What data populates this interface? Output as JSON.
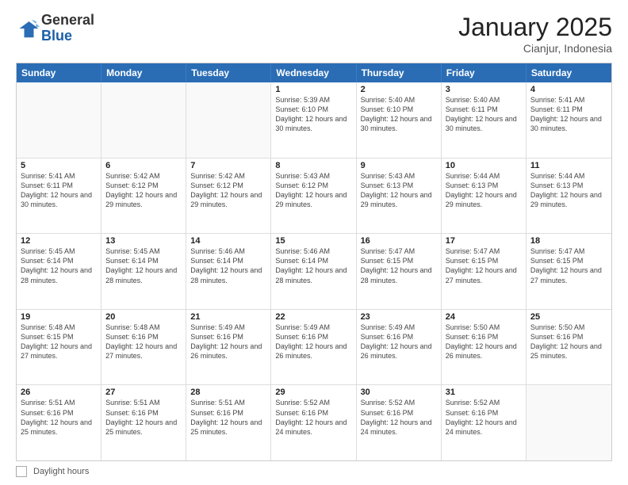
{
  "header": {
    "logo_general": "General",
    "logo_blue": "Blue",
    "month": "January 2025",
    "location": "Cianjur, Indonesia"
  },
  "footer": {
    "label": "Daylight hours"
  },
  "days": [
    "Sunday",
    "Monday",
    "Tuesday",
    "Wednesday",
    "Thursday",
    "Friday",
    "Saturday"
  ],
  "rows": [
    [
      {
        "day": "",
        "info": ""
      },
      {
        "day": "",
        "info": ""
      },
      {
        "day": "",
        "info": ""
      },
      {
        "day": "1",
        "info": "Sunrise: 5:39 AM\nSunset: 6:10 PM\nDaylight: 12 hours and 30 minutes."
      },
      {
        "day": "2",
        "info": "Sunrise: 5:40 AM\nSunset: 6:10 PM\nDaylight: 12 hours and 30 minutes."
      },
      {
        "day": "3",
        "info": "Sunrise: 5:40 AM\nSunset: 6:11 PM\nDaylight: 12 hours and 30 minutes."
      },
      {
        "day": "4",
        "info": "Sunrise: 5:41 AM\nSunset: 6:11 PM\nDaylight: 12 hours and 30 minutes."
      }
    ],
    [
      {
        "day": "5",
        "info": "Sunrise: 5:41 AM\nSunset: 6:11 PM\nDaylight: 12 hours and 30 minutes."
      },
      {
        "day": "6",
        "info": "Sunrise: 5:42 AM\nSunset: 6:12 PM\nDaylight: 12 hours and 29 minutes."
      },
      {
        "day": "7",
        "info": "Sunrise: 5:42 AM\nSunset: 6:12 PM\nDaylight: 12 hours and 29 minutes."
      },
      {
        "day": "8",
        "info": "Sunrise: 5:43 AM\nSunset: 6:12 PM\nDaylight: 12 hours and 29 minutes."
      },
      {
        "day": "9",
        "info": "Sunrise: 5:43 AM\nSunset: 6:13 PM\nDaylight: 12 hours and 29 minutes."
      },
      {
        "day": "10",
        "info": "Sunrise: 5:44 AM\nSunset: 6:13 PM\nDaylight: 12 hours and 29 minutes."
      },
      {
        "day": "11",
        "info": "Sunrise: 5:44 AM\nSunset: 6:13 PM\nDaylight: 12 hours and 29 minutes."
      }
    ],
    [
      {
        "day": "12",
        "info": "Sunrise: 5:45 AM\nSunset: 6:14 PM\nDaylight: 12 hours and 28 minutes."
      },
      {
        "day": "13",
        "info": "Sunrise: 5:45 AM\nSunset: 6:14 PM\nDaylight: 12 hours and 28 minutes."
      },
      {
        "day": "14",
        "info": "Sunrise: 5:46 AM\nSunset: 6:14 PM\nDaylight: 12 hours and 28 minutes."
      },
      {
        "day": "15",
        "info": "Sunrise: 5:46 AM\nSunset: 6:14 PM\nDaylight: 12 hours and 28 minutes."
      },
      {
        "day": "16",
        "info": "Sunrise: 5:47 AM\nSunset: 6:15 PM\nDaylight: 12 hours and 28 minutes."
      },
      {
        "day": "17",
        "info": "Sunrise: 5:47 AM\nSunset: 6:15 PM\nDaylight: 12 hours and 27 minutes."
      },
      {
        "day": "18",
        "info": "Sunrise: 5:47 AM\nSunset: 6:15 PM\nDaylight: 12 hours and 27 minutes."
      }
    ],
    [
      {
        "day": "19",
        "info": "Sunrise: 5:48 AM\nSunset: 6:15 PM\nDaylight: 12 hours and 27 minutes."
      },
      {
        "day": "20",
        "info": "Sunrise: 5:48 AM\nSunset: 6:16 PM\nDaylight: 12 hours and 27 minutes."
      },
      {
        "day": "21",
        "info": "Sunrise: 5:49 AM\nSunset: 6:16 PM\nDaylight: 12 hours and 26 minutes."
      },
      {
        "day": "22",
        "info": "Sunrise: 5:49 AM\nSunset: 6:16 PM\nDaylight: 12 hours and 26 minutes."
      },
      {
        "day": "23",
        "info": "Sunrise: 5:49 AM\nSunset: 6:16 PM\nDaylight: 12 hours and 26 minutes."
      },
      {
        "day": "24",
        "info": "Sunrise: 5:50 AM\nSunset: 6:16 PM\nDaylight: 12 hours and 26 minutes."
      },
      {
        "day": "25",
        "info": "Sunrise: 5:50 AM\nSunset: 6:16 PM\nDaylight: 12 hours and 25 minutes."
      }
    ],
    [
      {
        "day": "26",
        "info": "Sunrise: 5:51 AM\nSunset: 6:16 PM\nDaylight: 12 hours and 25 minutes."
      },
      {
        "day": "27",
        "info": "Sunrise: 5:51 AM\nSunset: 6:16 PM\nDaylight: 12 hours and 25 minutes."
      },
      {
        "day": "28",
        "info": "Sunrise: 5:51 AM\nSunset: 6:16 PM\nDaylight: 12 hours and 25 minutes."
      },
      {
        "day": "29",
        "info": "Sunrise: 5:52 AM\nSunset: 6:16 PM\nDaylight: 12 hours and 24 minutes."
      },
      {
        "day": "30",
        "info": "Sunrise: 5:52 AM\nSunset: 6:16 PM\nDaylight: 12 hours and 24 minutes."
      },
      {
        "day": "31",
        "info": "Sunrise: 5:52 AM\nSunset: 6:16 PM\nDaylight: 12 hours and 24 minutes."
      },
      {
        "day": "",
        "info": ""
      }
    ]
  ]
}
